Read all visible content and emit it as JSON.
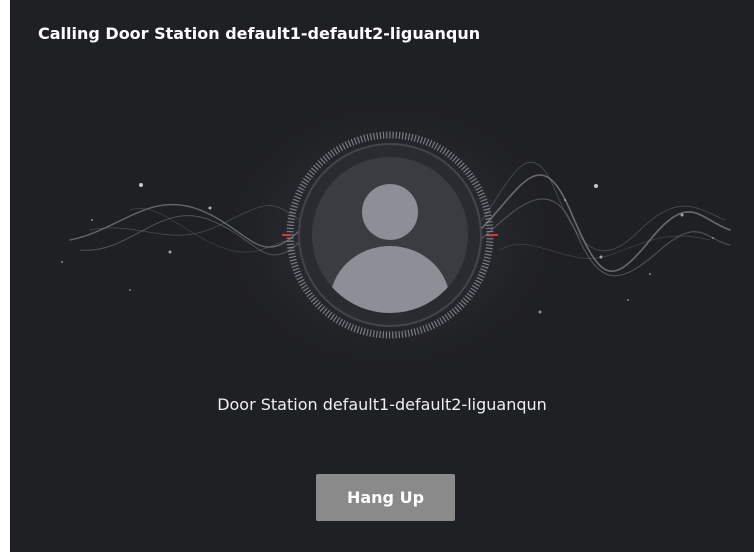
{
  "dialog": {
    "title": "Calling Door Station default1-default2-liguanqun",
    "caller_name": "Door Station default1-default2-liguanqun",
    "hangup_label": "Hang Up"
  },
  "icons": {
    "avatar": "user-avatar-icon",
    "ring": "calling-ring-icon",
    "waves": "sound-wave-decoration"
  },
  "colors": {
    "background": "#1f2023",
    "avatar_fill": "#8d8e96",
    "avatar_bg": "#3b3c42",
    "ring": "#8a8b92",
    "ring_accent": "#d23b3b",
    "button": "#8a8a8a"
  }
}
